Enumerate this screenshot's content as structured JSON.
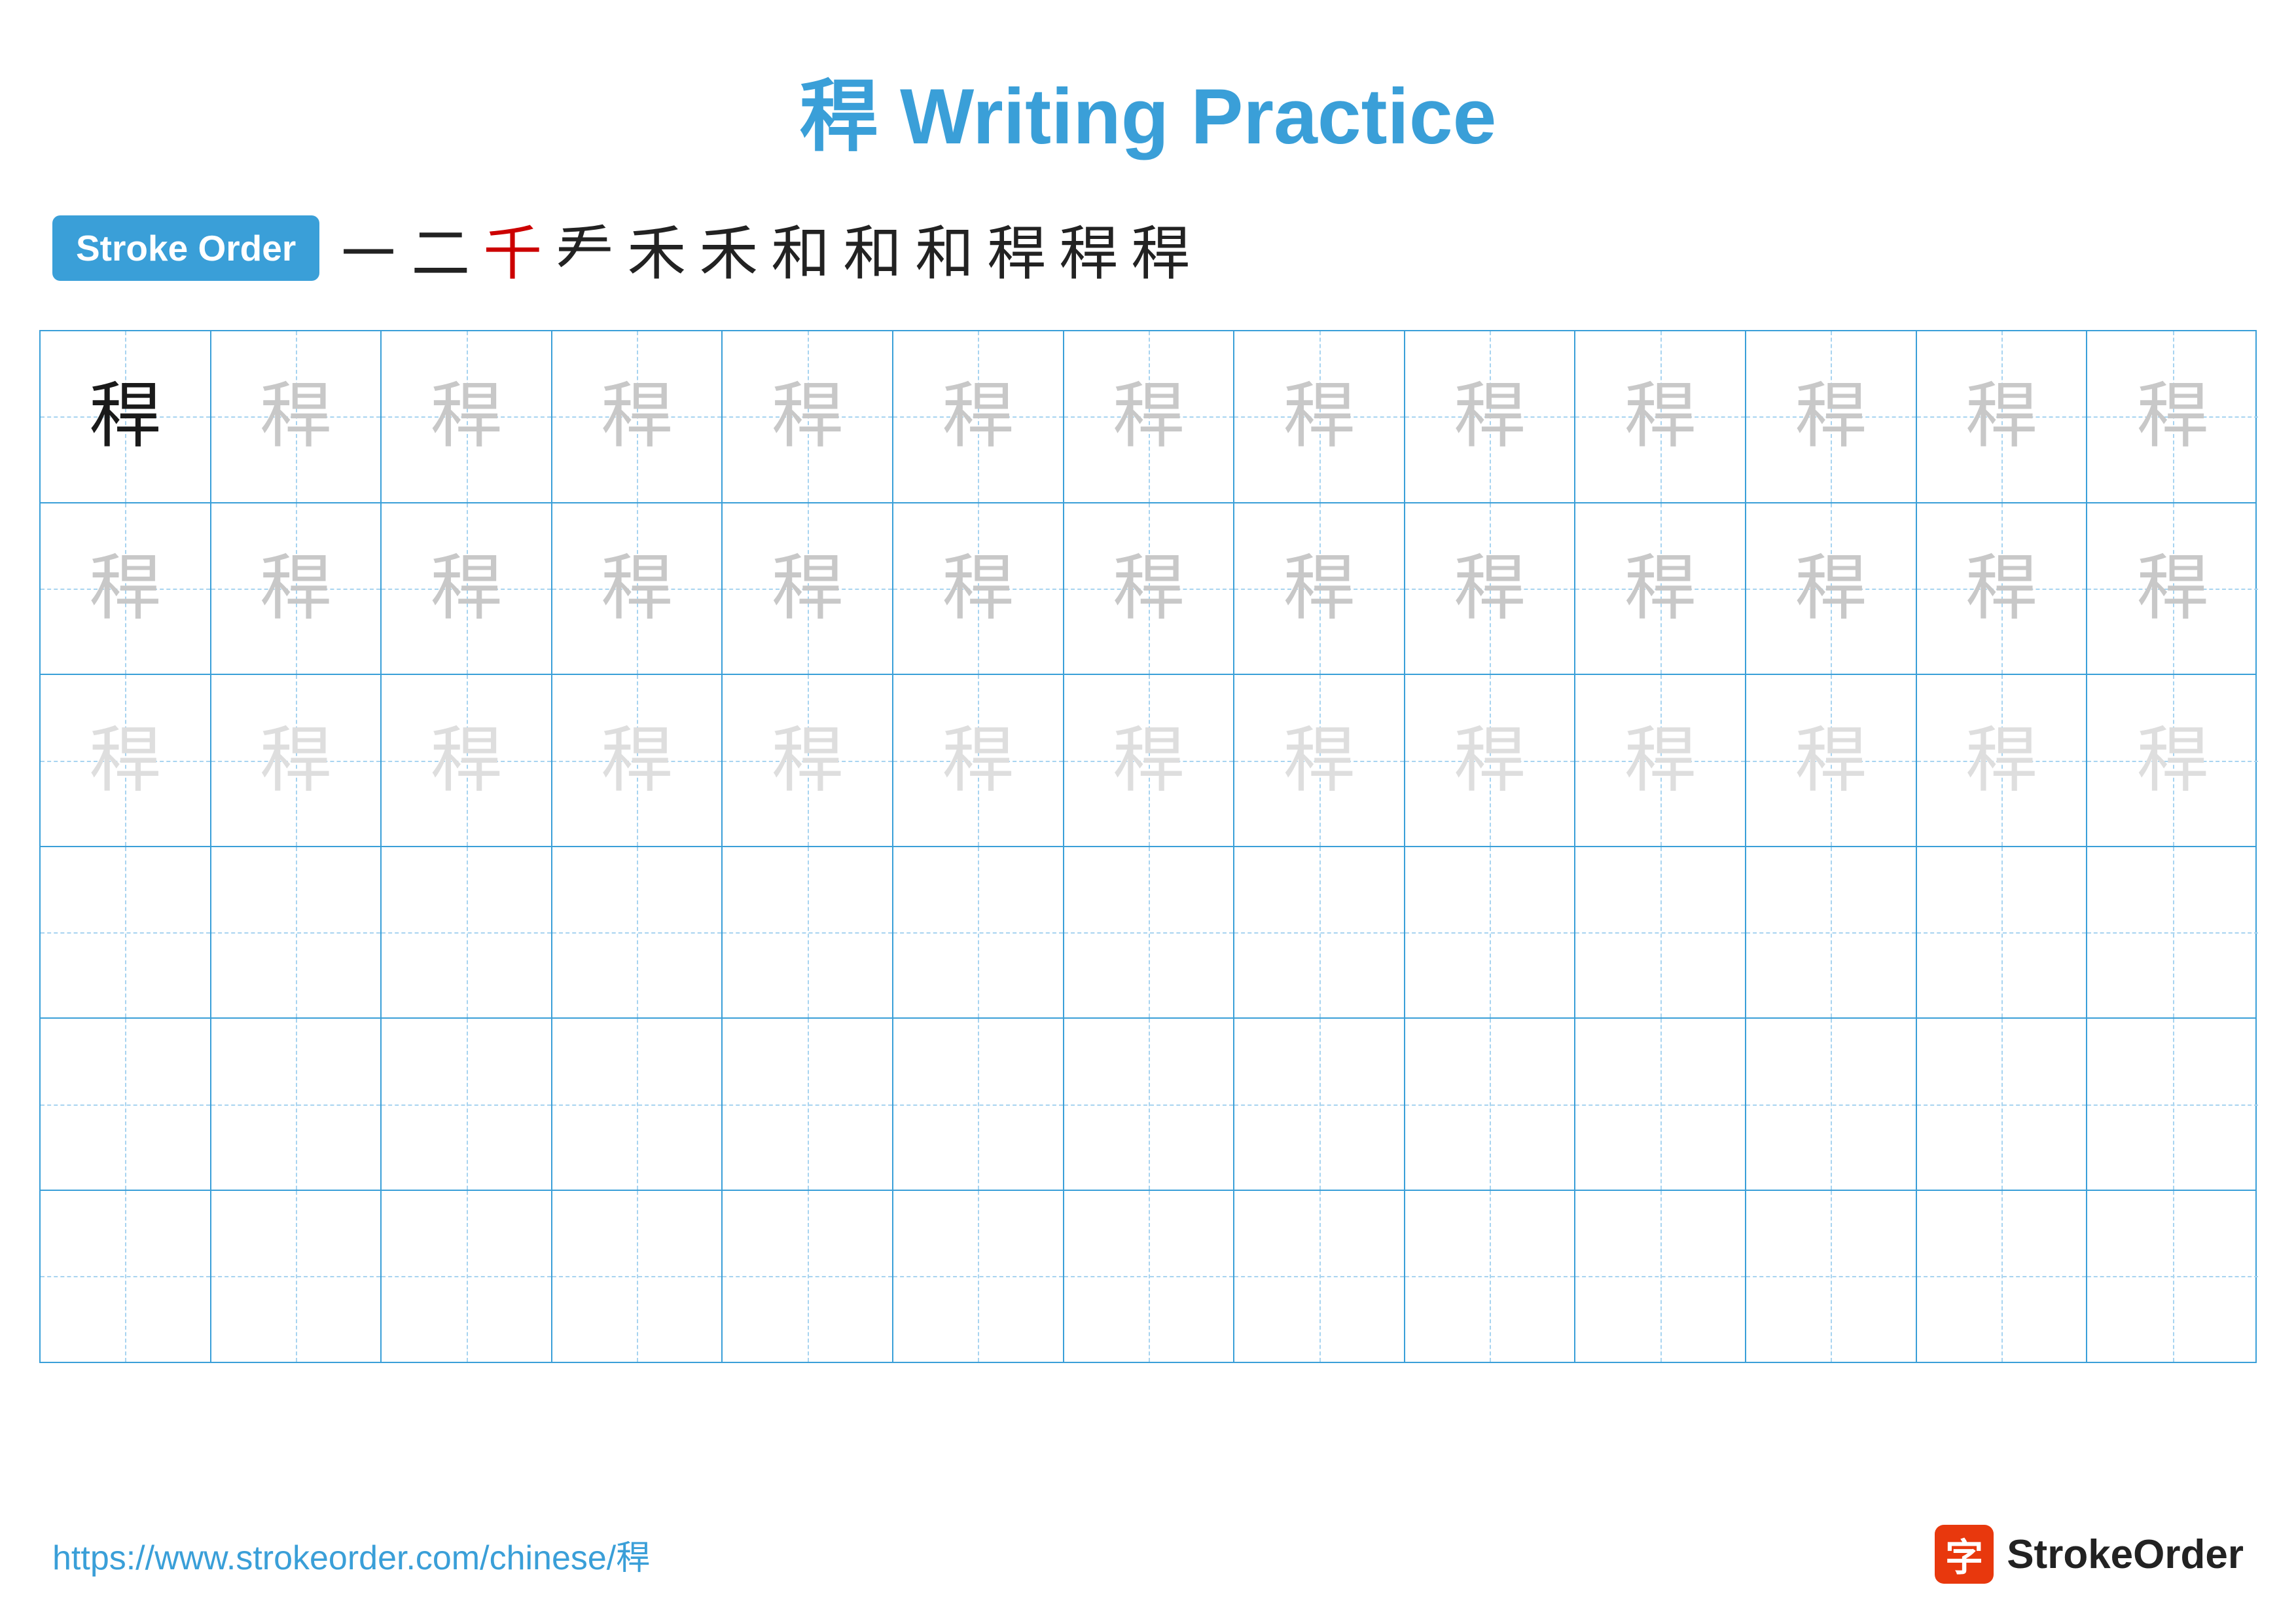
{
  "page": {
    "title": "稈 Writing Practice",
    "stroke_order_label": "Stroke Order",
    "url": "https://www.strokeorder.com/chinese/稈",
    "logo_text": "StrokeOrder",
    "logo_char": "字",
    "character": "稈"
  },
  "stroke_sequence": [
    "㇐",
    "二",
    "千",
    "龵",
    "禾",
    "禾",
    "和",
    "和",
    "和",
    "稈",
    "稈",
    "稈"
  ],
  "rows": [
    {
      "type": "dark_then_medium",
      "chars": [
        "稈",
        "稈",
        "稈",
        "稈",
        "稈",
        "稈",
        "稈",
        "稈",
        "稈",
        "稈",
        "稈",
        "稈",
        "稈"
      ]
    },
    {
      "type": "medium",
      "chars": [
        "稈",
        "稈",
        "稈",
        "稈",
        "稈",
        "稈",
        "稈",
        "稈",
        "稈",
        "稈",
        "稈",
        "稈",
        "稈"
      ]
    },
    {
      "type": "light",
      "chars": [
        "稈",
        "稈",
        "稈",
        "稈",
        "稈",
        "稈",
        "稈",
        "稈",
        "稈",
        "稈",
        "稈",
        "稈",
        "稈"
      ]
    },
    {
      "type": "empty"
    },
    {
      "type": "empty"
    },
    {
      "type": "empty"
    }
  ]
}
